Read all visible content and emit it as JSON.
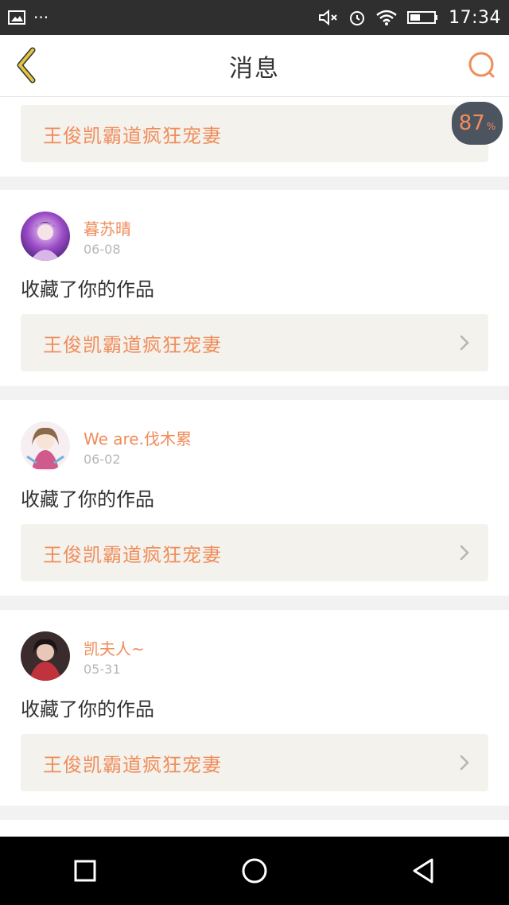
{
  "status_bar": {
    "time": "17:34",
    "icons": [
      "image-icon",
      "more-icon",
      "mute-icon",
      "alarm-icon",
      "wifi-icon",
      "battery-icon"
    ]
  },
  "header": {
    "title": "消息",
    "back_icon": "chevron-left-icon",
    "search_icon": "search-icon"
  },
  "colors": {
    "accent": "#f08c5a",
    "back_icon": "#e1c640",
    "card_bg": "#ffffff",
    "page_bg": "#f2f2f2",
    "work_bg": "#f4f2ed"
  },
  "progress_badge": {
    "value": "87",
    "unit": "%"
  },
  "messages": [
    {
      "user": "",
      "date": "",
      "action": "",
      "work_title": "王俊凯霸道疯狂宠妻"
    },
    {
      "user": "暮苏晴",
      "date": "06-08",
      "action": "收藏了你的作品",
      "work_title": "王俊凯霸道疯狂宠妻"
    },
    {
      "user": "We are.伐木累",
      "date": "06-02",
      "action": "收藏了你的作品",
      "work_title": "王俊凯霸道疯狂宠妻"
    },
    {
      "user": "凯夫人~",
      "date": "05-31",
      "action": "收藏了你的作品",
      "work_title": "王俊凯霸道疯狂宠妻"
    }
  ],
  "nav_bar": [
    "recent-apps-icon",
    "home-icon",
    "back-icon"
  ]
}
